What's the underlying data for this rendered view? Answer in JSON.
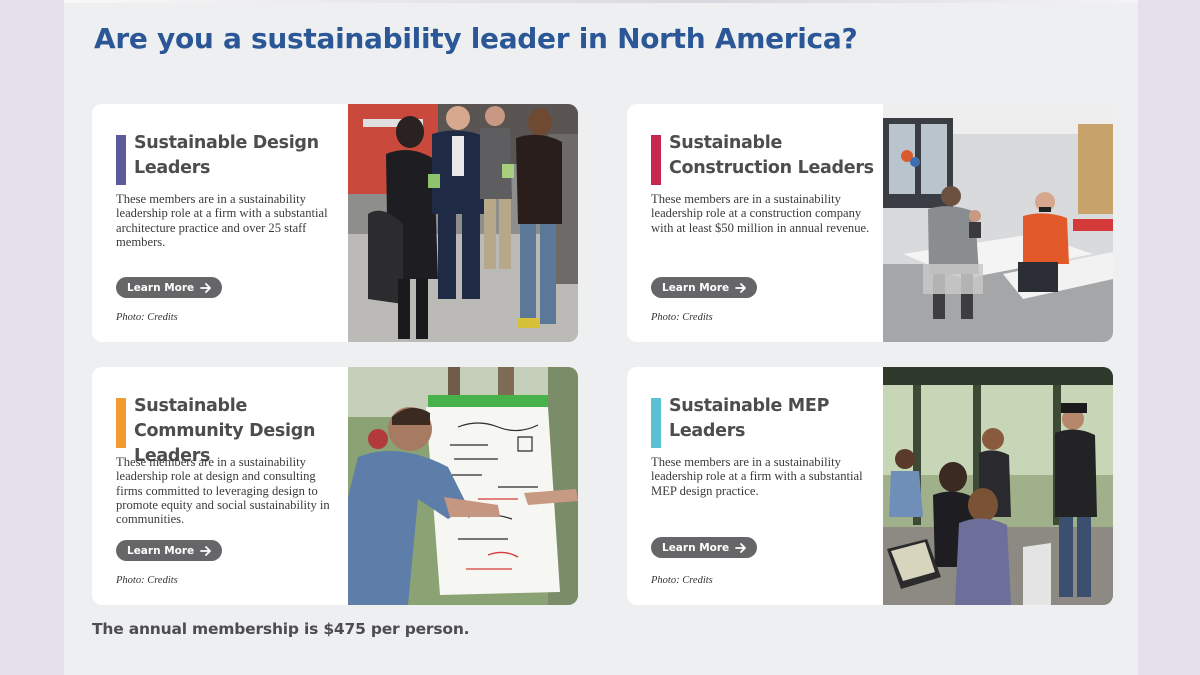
{
  "headline": "Are you a sustainability leader in North America?",
  "cards": [
    {
      "title": "Sustainable Design Leaders",
      "description": "These members are in a sustainability leadership role at a firm with a substantial architecture practice and over 25 staff members.",
      "button_label": "Learn More",
      "photo_credit": "Photo: Credits",
      "accent_color": "#5b5b9c"
    },
    {
      "title": "Sustainable Construction Leaders",
      "description": "These members are in a sustainability leadership role at a construction company with at least $50 million in annual revenue.",
      "button_label": "Learn More",
      "photo_credit": "Photo: Credits",
      "accent_color": "#c8284f"
    },
    {
      "title": "Sustainable Community Design Leaders",
      "description": "These members are in a sustainability leadership role at design and consulting firms committed to leveraging design to promote equity and social sustainability in communities.",
      "button_label": "Learn More",
      "photo_credit": "Photo: Credits",
      "accent_color": "#f29b30"
    },
    {
      "title": "Sustainable MEP Leaders",
      "description": "These members are in a sustainability leadership role at a firm with a substantial MEP design practice.",
      "button_label": "Learn More",
      "photo_credit": "Photo: Credits",
      "accent_color": "#5bc2d3"
    }
  ],
  "footer_note": "The annual membership is $475 per person.",
  "icons": {
    "button_icon": "arrow-right-icon"
  },
  "colors": {
    "headline": "#2b5797",
    "page_background": "#eeeff1",
    "outer_background": "#e4e1ed",
    "button": "#666668"
  }
}
